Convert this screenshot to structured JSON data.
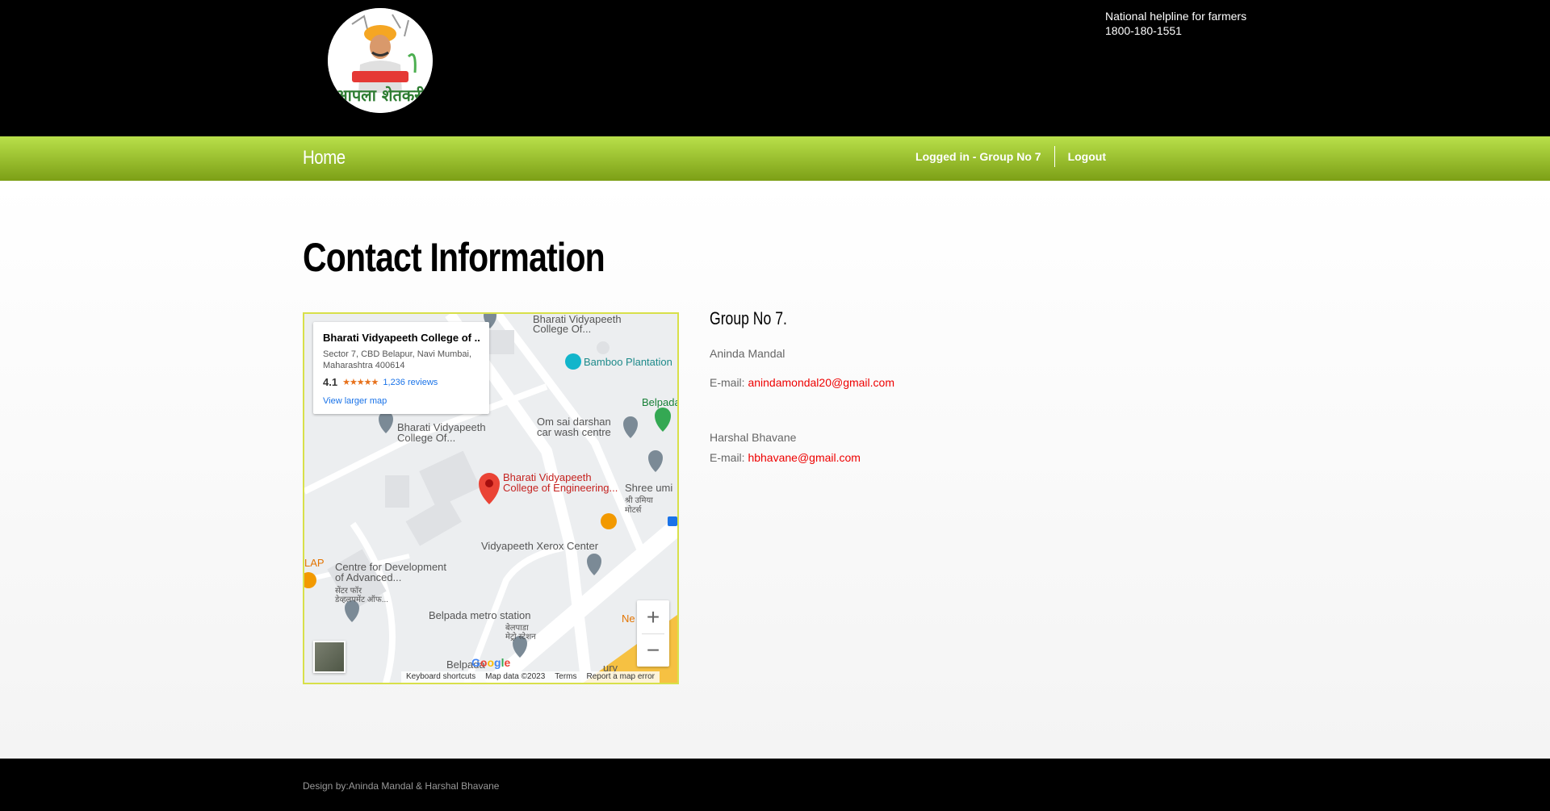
{
  "header": {
    "logo_text": "आपला शेतकरी",
    "helpline_label": "National helpline for farmers",
    "helpline_number": "1800-180-1551"
  },
  "nav": {
    "home": "Home",
    "logged_in": "Logged in - Group No 7",
    "logout": "Logout"
  },
  "page_title": "Contact Information",
  "map": {
    "card": {
      "title": "Bharati Vidyapeeth College of ...",
      "address_line1": "Sector 7, CBD Belapur, Navi Mumbai,",
      "address_line2": "Maharashtra 400614",
      "rating": "4.1",
      "stars": "★★★★★",
      "reviews": "1,236 reviews",
      "larger_map": "View larger map"
    },
    "labels": {
      "bv_top_1": "Bharati Vidyapeeth",
      "bv_top_2": "College Of...",
      "bamboo": "Bamboo Plantation",
      "belpada": "Belpada",
      "carwash_1": "Om sai darshan",
      "carwash_2": "car wash centre",
      "bv_mid_1": "Bharati Vidyapeeth",
      "bv_mid_2": "College Of...",
      "main_pin_1": "Bharati Vidyapeeth",
      "main_pin_2": "College of Engineering...",
      "shree_1": "Shree umi",
      "shree_2": "श्री उमिया",
      "shree_3": "मोटर्स",
      "xerox": "Vidyapeeth Xerox Center",
      "lap": "LAP",
      "cfd_1": "Centre for Development",
      "cfd_2": "of Advanced...",
      "cfd_3": "सेंटर फॉर",
      "cfd_4": "डेव्हलपमेंट ऑफ...",
      "metro_1": "Belpada metro station",
      "metro_2": "बेलपाडा",
      "metro_3": "मेट्रो स्टेशन",
      "ne_op": "Ne op",
      "belpada_bottom": "Belpada",
      "ury": "ury"
    },
    "zoom_in": "+",
    "zoom_out": "−",
    "google": "Google",
    "footer": {
      "shortcuts": "Keyboard shortcuts",
      "data": "Map data ©2023",
      "terms": "Terms",
      "report": "Report a map error"
    }
  },
  "contact": {
    "group_title": "Group No 7.",
    "person1_name": "Aninda Mandal",
    "email_label": "E-mail:",
    "person1_email": "anindamondal20@gmail.com",
    "person2_name": "Harshal Bhavane",
    "person2_email": "hbhavane@gmail.com"
  },
  "footer": {
    "credit": "Design by:Aninda Mandal & Harshal Bhavane"
  }
}
